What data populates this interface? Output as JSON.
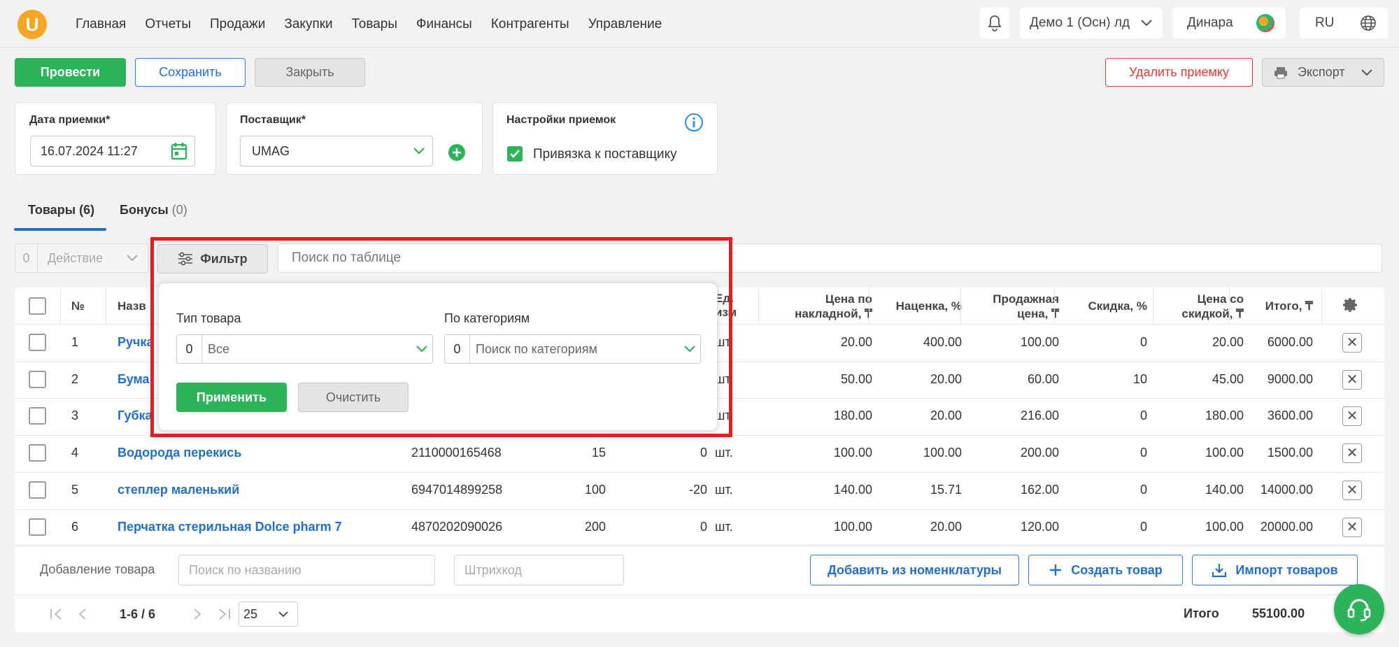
{
  "nav": {
    "logo": "U",
    "items": [
      "Главная",
      "Отчеты",
      "Продажи",
      "Закупки",
      "Товары",
      "Финансы",
      "Контрагенты",
      "Управление"
    ],
    "company": "Демо 1 (Осн) лд",
    "user": "Динара",
    "lang": "RU"
  },
  "toolbar": {
    "post": "Провести",
    "save": "Сохранить",
    "close": "Закрыть",
    "delete": "Удалить приемку",
    "export": "Экспорт"
  },
  "receipt": {
    "date_label": "Дата приемки*",
    "date_value": "16.07.2024 11:27",
    "supplier_label": "Поставщик*",
    "supplier_value": "UMAG",
    "settings_label": "Настройки приемок",
    "bind_supplier": "Привязка к поставщику",
    "bind_checked": true
  },
  "tabs": {
    "goods": "Товары",
    "goods_count": "(6)",
    "bonus": "Бонусы",
    "bonus_count": "(0)"
  },
  "actions": {
    "selected_count": "0",
    "action_label": "Действие",
    "filter_label": "Фильтр",
    "search_placeholder": "Поиск по таблице"
  },
  "table": {
    "headers": {
      "num": "№",
      "name": "Назв",
      "unit_1": "Ед.",
      "unit_2": "изм",
      "price_inv_1": "Цена по",
      "price_inv_2": "накладной, ₸",
      "markup": "Наценка, %",
      "sale_1": "Продажная",
      "sale_2": "цена, ₸",
      "discount": "Скидка, %",
      "disc_price_1": "Цена со",
      "disc_price_2": "скидкой, ₸",
      "total": "Итого, ₸"
    },
    "rows": [
      {
        "n": "1",
        "name": "Ручка",
        "barcode": "",
        "qty": "",
        "diff": "",
        "unit": "шт.",
        "price": "20.00",
        "markup": "400.00",
        "sale": "100.00",
        "disc": "0",
        "disc_price": "20.00",
        "total": "6000.00"
      },
      {
        "n": "2",
        "name": "Бума",
        "barcode": "",
        "qty": "",
        "diff": "",
        "unit": "шт.",
        "price": "50.00",
        "markup": "20.00",
        "sale": "60.00",
        "disc": "10",
        "disc_price": "45.00",
        "total": "9000.00"
      },
      {
        "n": "3",
        "name": "Губка",
        "barcode": "",
        "qty": "",
        "diff": "",
        "unit": "шт.",
        "price": "180.00",
        "markup": "20.00",
        "sale": "216.00",
        "disc": "0",
        "disc_price": "180.00",
        "total": "3600.00"
      },
      {
        "n": "4",
        "name": "Водорода перекись",
        "barcode": "2110000165468",
        "qty": "15",
        "diff": "0",
        "unit": "шт.",
        "price": "100.00",
        "markup": "100.00",
        "sale": "200.00",
        "disc": "0",
        "disc_price": "100.00",
        "total": "1500.00"
      },
      {
        "n": "5",
        "name": "степлер маленький",
        "barcode": "6947014899258",
        "qty": "100",
        "diff": "-20",
        "unit": "шт.",
        "price": "140.00",
        "markup": "15.71",
        "sale": "162.00",
        "disc": "0",
        "disc_price": "140.00",
        "total": "14000.00"
      },
      {
        "n": "6",
        "name": "Перчатка стерильная Dolce pharm 7",
        "barcode": "4870202090026",
        "qty": "200",
        "diff": "0",
        "unit": "шт.",
        "price": "100.00",
        "markup": "20.00",
        "sale": "120.00",
        "disc": "0",
        "disc_price": "100.00",
        "total": "20000.00"
      }
    ]
  },
  "add_product": {
    "label": "Добавление товара",
    "name_placeholder": "Поиск по названию",
    "barcode_placeholder": "Штрихкод",
    "from_nomenclature": "Добавить из номенклатуры",
    "create": "Создать товар",
    "import": "Импорт товаров"
  },
  "pagination": {
    "range": "1-6 / 6",
    "per_page": "25",
    "total_label": "Итого",
    "total_value": "55100.00"
  },
  "filter_popup": {
    "type_label": "Тип товара",
    "type_count": "0",
    "type_value": "Все",
    "category_label": "По категориям",
    "category_count": "0",
    "category_placeholder": "Поиск по категориям",
    "apply": "Применить",
    "clear": "Очистить"
  },
  "colors": {
    "green": "#2bb459",
    "blue": "#1f6fd1",
    "red": "#e53935",
    "highlight": "#e21d24"
  }
}
